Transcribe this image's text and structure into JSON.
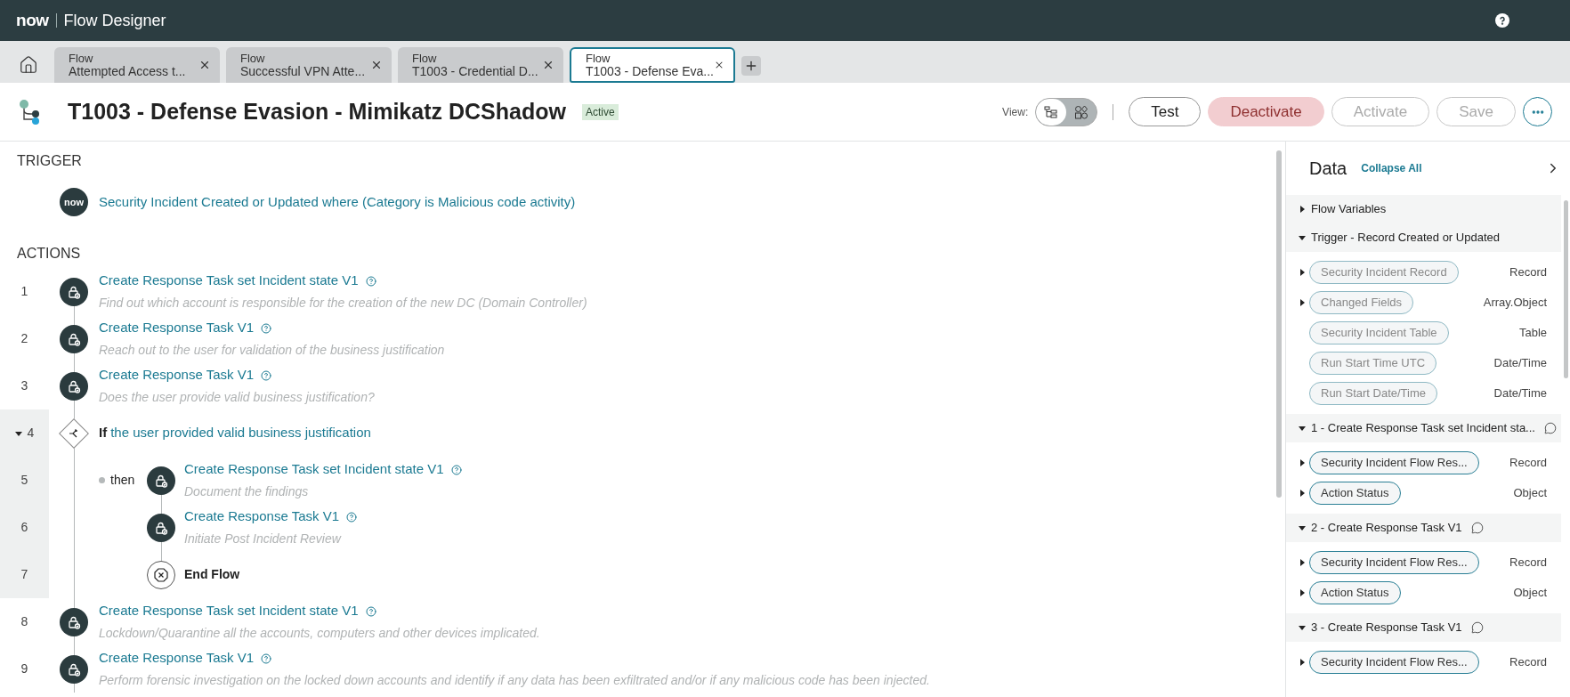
{
  "app_bar": {
    "logo": "now",
    "title": "Flow Designer"
  },
  "tabs": [
    {
      "type": "Flow",
      "name": "Attempted Access t...",
      "selected": false
    },
    {
      "type": "Flow",
      "name": "Successful VPN Atte...",
      "selected": false
    },
    {
      "type": "Flow",
      "name": "T1003 - Credential D...",
      "selected": false
    },
    {
      "type": "Flow",
      "name": "T1003 - Defense Eva...",
      "selected": true
    }
  ],
  "header": {
    "title": "T1003 - Defense Evasion - Mimikatz DCShadow",
    "status": "Active",
    "view_label": "View:",
    "view_modes": [
      {
        "kind": "tree",
        "selected": true
      },
      {
        "kind": "diagram",
        "selected": false
      }
    ],
    "buttons": [
      {
        "label": "Test",
        "kind": "default",
        "disabled": false
      },
      {
        "label": "Deactivate",
        "kind": "danger",
        "disabled": false
      },
      {
        "label": "Activate",
        "kind": "default",
        "disabled": true
      },
      {
        "label": "Save",
        "kind": "default",
        "disabled": true
      }
    ]
  },
  "trigger": {
    "heading": "TRIGGER",
    "badge": "now",
    "text": "Security Incident Created or Updated where (Category is Malicious code activity)"
  },
  "actions": {
    "heading": "ACTIONS",
    "steps": [
      {
        "kind": "action",
        "number": "1",
        "title": "Create Response Task set Incident state V1",
        "description": "Find out which account is responsible for the creation of the new DC (Domain Controller)"
      },
      {
        "kind": "action",
        "number": "2",
        "title": "Create Response Task V1",
        "description": "Reach out to the user for validation of the business justification"
      },
      {
        "kind": "action",
        "number": "3",
        "title": "Create Response Task V1",
        "description": "Does the user provide valid business justification?"
      },
      {
        "kind": "if",
        "number": "4",
        "label": "If",
        "condition": "the user provided valid business justification",
        "expanded": true,
        "branch_label": "then",
        "children": [
          {
            "kind": "action",
            "number": "5",
            "title": "Create Response Task set Incident state V1",
            "description": "Document the findings"
          },
          {
            "kind": "action",
            "number": "6",
            "title": "Create Response Task V1",
            "description": "Initiate Post Incident Review"
          },
          {
            "kind": "end",
            "number": "7",
            "title": "End Flow"
          }
        ]
      },
      {
        "kind": "action",
        "number": "8",
        "title": "Create Response Task set Incident state V1",
        "description": "Lockdown/Quarantine all the accounts, computers and other devices implicated."
      },
      {
        "kind": "action",
        "number": "9",
        "title": "Create Response Task V1",
        "description": "Perform forensic investigation on the locked down accounts and identify if any data has been exfiltrated and/or if any malicious code has been injected."
      }
    ]
  },
  "data_panel": {
    "title": "Data",
    "collapse_link": "Collapse All",
    "sections": [
      {
        "title": "Flow Variables",
        "expanded": false,
        "comment": false
      },
      {
        "title": "Trigger - Record Created or Updated",
        "expanded": true,
        "comment": false,
        "items": [
          {
            "pill": "Security Incident Record",
            "type": "Record",
            "expandable": true,
            "dimmed": true
          },
          {
            "pill": "Changed Fields",
            "type": "Array.Object",
            "expandable": true,
            "dimmed": true
          },
          {
            "pill": "Security Incident Table",
            "type": "Table",
            "expandable": false,
            "dimmed": true
          },
          {
            "pill": "Run Start Time UTC",
            "type": "Date/Time",
            "expandable": false,
            "dimmed": true
          },
          {
            "pill": "Run Start Date/Time",
            "type": "Date/Time",
            "expandable": false,
            "dimmed": true
          }
        ]
      },
      {
        "title": "1 - Create Response Task set Incident sta...",
        "expanded": true,
        "comment": true,
        "items": [
          {
            "pill": "Security Incident Flow Res...",
            "type": "Record",
            "expandable": true,
            "dimmed": false
          },
          {
            "pill": "Action Status",
            "type": "Object",
            "expandable": true,
            "dimmed": false
          }
        ]
      },
      {
        "title": "2 - Create Response Task V1",
        "expanded": true,
        "comment": true,
        "items": [
          {
            "pill": "Security Incident Flow Res...",
            "type": "Record",
            "expandable": true,
            "dimmed": false
          },
          {
            "pill": "Action Status",
            "type": "Object",
            "expandable": true,
            "dimmed": false
          }
        ]
      },
      {
        "title": "3 - Create Response Task V1",
        "expanded": true,
        "comment": true,
        "items": [
          {
            "pill": "Security Incident Flow Res...",
            "type": "Record",
            "expandable": true,
            "dimmed": false
          }
        ]
      }
    ]
  }
}
